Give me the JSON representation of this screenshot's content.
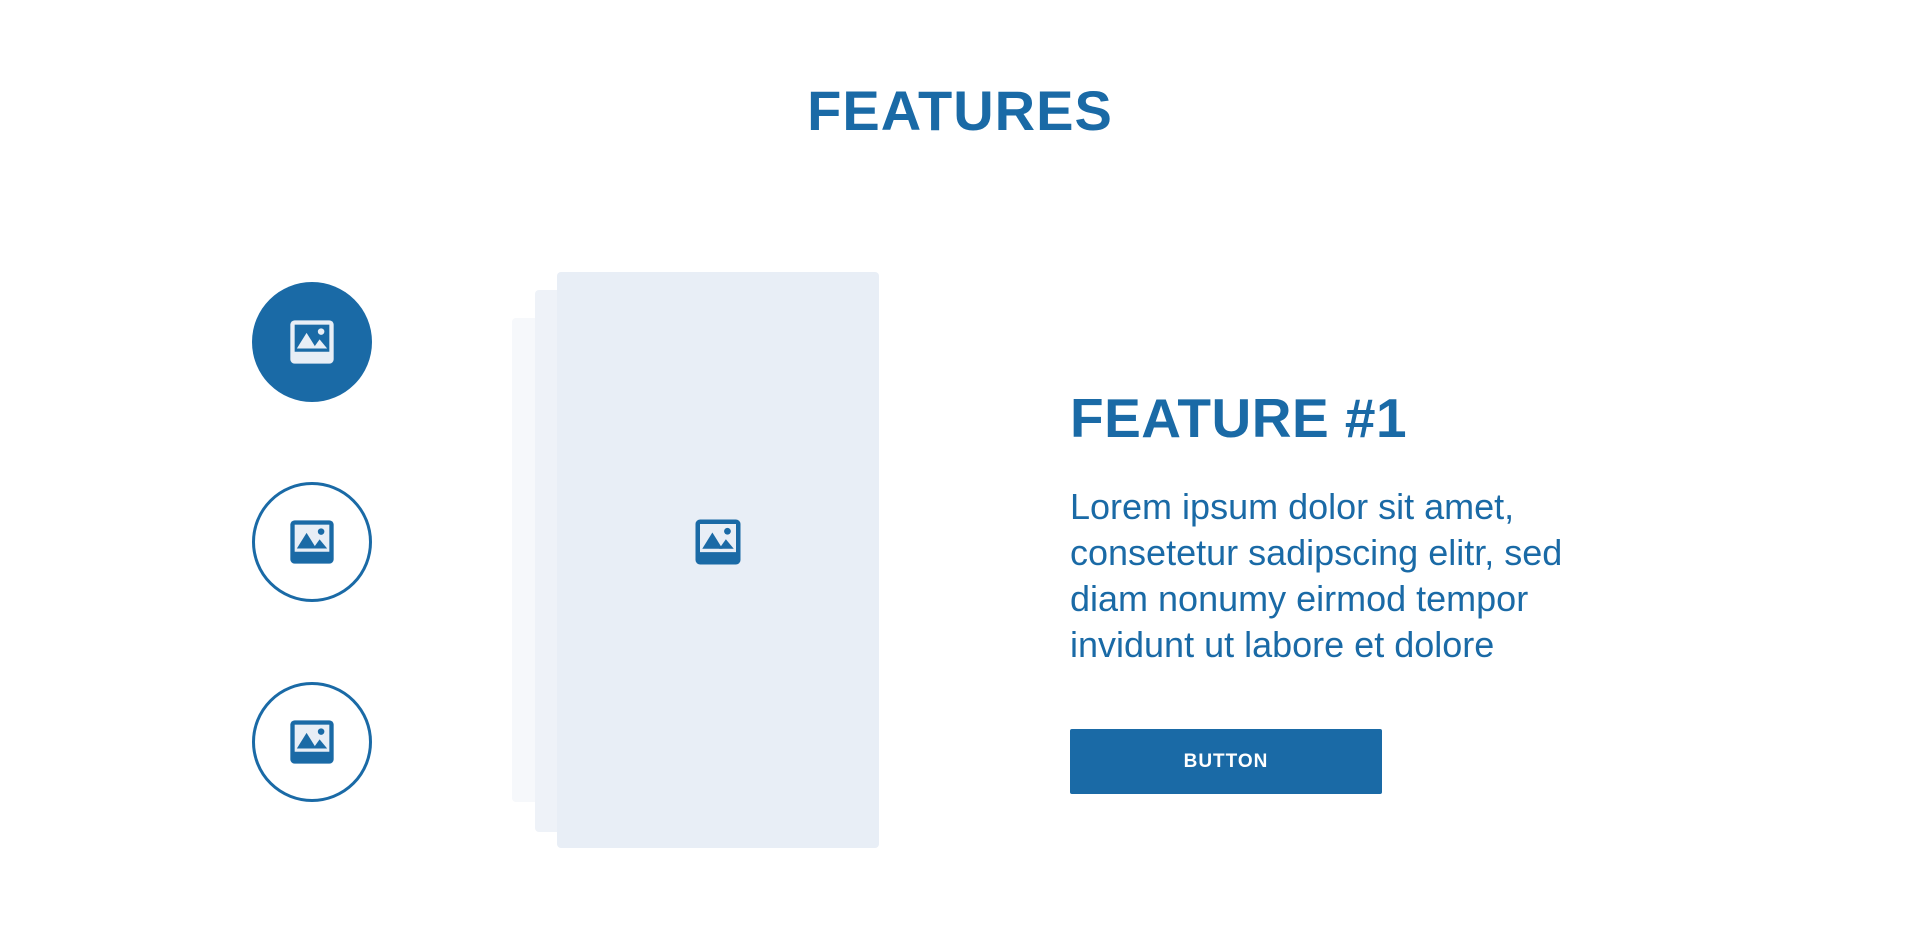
{
  "section": {
    "title": "FEATURES"
  },
  "tabs": [
    {
      "icon": "image-icon",
      "active": true
    },
    {
      "icon": "image-icon",
      "active": false
    },
    {
      "icon": "image-icon",
      "active": false
    }
  ],
  "preview": {
    "icon": "image-icon"
  },
  "feature": {
    "heading": "FEATURE #1",
    "description": "Lorem ipsum dolor sit amet, consetetur sadipscing elitr, sed diam nonumy eirmod tempor invidunt ut labore et dolore",
    "button_label": "BUTTON"
  },
  "colors": {
    "accent": "#1a6aa6",
    "card_front": "#e8eef6",
    "card_back": "#eef2f8",
    "card_back_far": "#f6f8fb",
    "background": "#ffffff"
  }
}
